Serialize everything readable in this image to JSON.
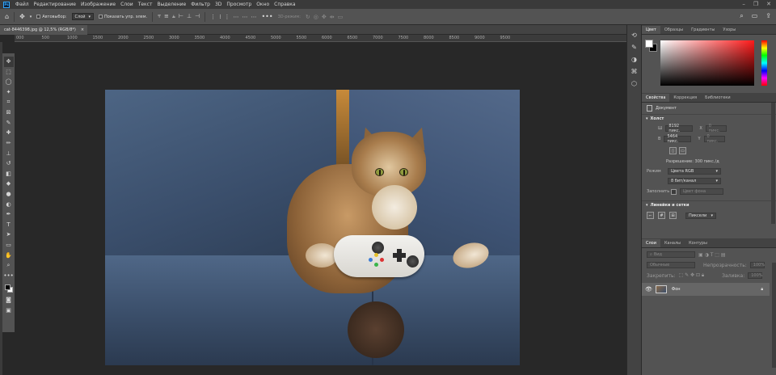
{
  "app": {
    "logo": "Ps"
  },
  "menu": [
    "Файл",
    "Редактирование",
    "Изображение",
    "Слои",
    "Текст",
    "Выделение",
    "Фильтр",
    "3D",
    "Просмотр",
    "Окно",
    "Справка"
  ],
  "options_bar": {
    "autoselect_label": "Автовыбор:",
    "autoselect_value": "Слой",
    "show_controls_label": "Показать упр. элем.",
    "mode_3d_label": "3D-режим:"
  },
  "document_tab": {
    "title": "cat-8446398.jpg @ 12,5% (RGB/8*)",
    "close": "×"
  },
  "ruler_ticks": [
    "000",
    "500",
    "1000",
    "1500",
    "2000",
    "2500",
    "3000",
    "3500",
    "4000",
    "4500",
    "5000",
    "5500",
    "6000",
    "6500",
    "7000",
    "7500",
    "8000",
    "8500",
    "9000",
    "9500"
  ],
  "color_panel": {
    "tabs": [
      "Цвет",
      "Образцы",
      "Градиенты",
      "Узоры"
    ],
    "active_tab": "Цвет"
  },
  "properties_panel": {
    "tabs": [
      "Свойства",
      "Коррекция",
      "Библиотеки"
    ],
    "active_tab": "Свойства",
    "doc_label": "Документ",
    "canvas_section": "Холст",
    "width_label": "Ш",
    "width_value": "8192 пикс.",
    "x_label": "X",
    "x_placeholder": "0 пикс.",
    "height_label": "В",
    "height_value": "5464 пикс.",
    "y_label": "Y",
    "y_placeholder": "0 пикс.",
    "resolution": "Разрешение: 300 пикс./д",
    "mode_label": "Режим",
    "mode_value": "Цвета RGB",
    "bit_value": "8 бит/канал",
    "fill_label": "Заполнить",
    "fill_value": "Цвет фона",
    "rulers_section": "Линейки и сетки",
    "units_value": "Пиксели"
  },
  "layers_panel": {
    "tabs": [
      "Слои",
      "Каналы",
      "Контуры"
    ],
    "active_tab": "Слои",
    "filter_placeholder": "Вид",
    "blend_mode": "Обычные",
    "opacity_label": "Непрозрачность:",
    "opacity_value": "100%",
    "lock_label": "Закрепить:",
    "fill_label": "Заливка:",
    "fill_value": "100%",
    "layer_name": "Фон"
  },
  "colors": {
    "accent": "#31a8ff",
    "panel": "#535353",
    "workspace": "#282828"
  }
}
